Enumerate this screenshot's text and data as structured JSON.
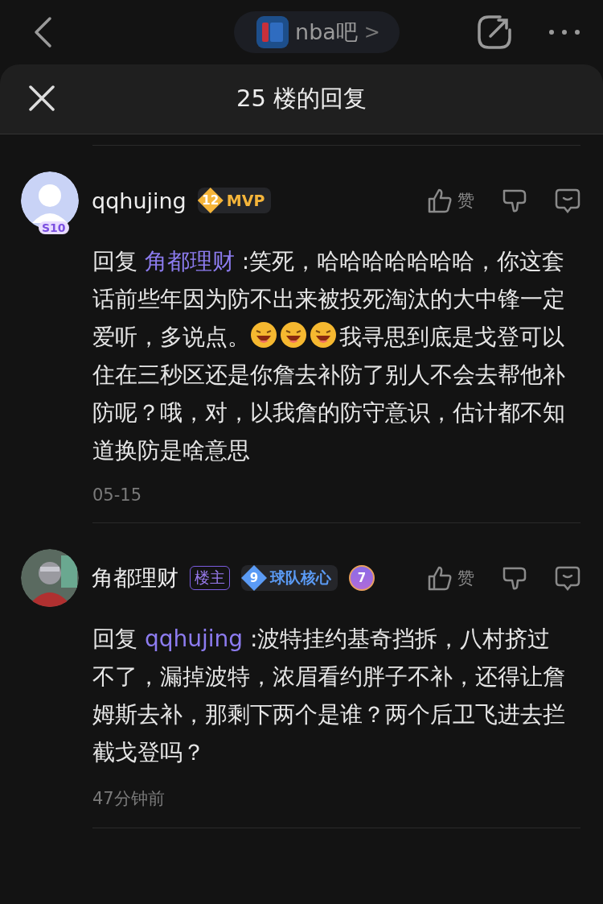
{
  "top_bar": {
    "forum": "nba吧",
    "forum_chevron": ">"
  },
  "sheet": {
    "title": "25 楼的回复"
  },
  "comments": [
    {
      "avatar_badge": "S10",
      "name": "qqhujing",
      "level": "12",
      "level_title": "MVP",
      "color": "#f5b53a",
      "is_op": false,
      "like_label": "赞",
      "body": [
        {
          "kind": "text",
          "text": "回复 "
        },
        {
          "kind": "mention",
          "text": "角都理财"
        },
        {
          "kind": "text",
          "text": " :笑死，哈哈哈哈哈哈哈，你这套话前些年因为防不出来被投死淘汰的大中锋一定爱听，多说点。"
        },
        {
          "kind": "emoji"
        },
        {
          "kind": "emoji"
        },
        {
          "kind": "emoji"
        },
        {
          "kind": "text",
          "text": "我寻思到底是戈登可以住在三秒区还是你詹去补防了别人不会去帮他补防呢？哦，对，以我詹的防守意识，估计都不知道换防是啥意思"
        }
      ],
      "time": "05-15"
    },
    {
      "name": "角都理财",
      "level": "9",
      "level_title": "球队核心",
      "color": "#5b9bf5",
      "is_op": true,
      "op_label": "楼主",
      "extra_badge": "7",
      "like_label": "赞",
      "body": [
        {
          "kind": "text",
          "text": "回复 "
        },
        {
          "kind": "mention",
          "text": "qqhujing"
        },
        {
          "kind": "text",
          "text": " :波特挂约基奇挡拆，八村挤过不了，漏掉波特，浓眉看约胖子不补，还得让詹姆斯去补，那剩下两个是谁？两个后卫飞进去拦截戈登吗？"
        }
      ],
      "time": "47分钟前"
    }
  ]
}
